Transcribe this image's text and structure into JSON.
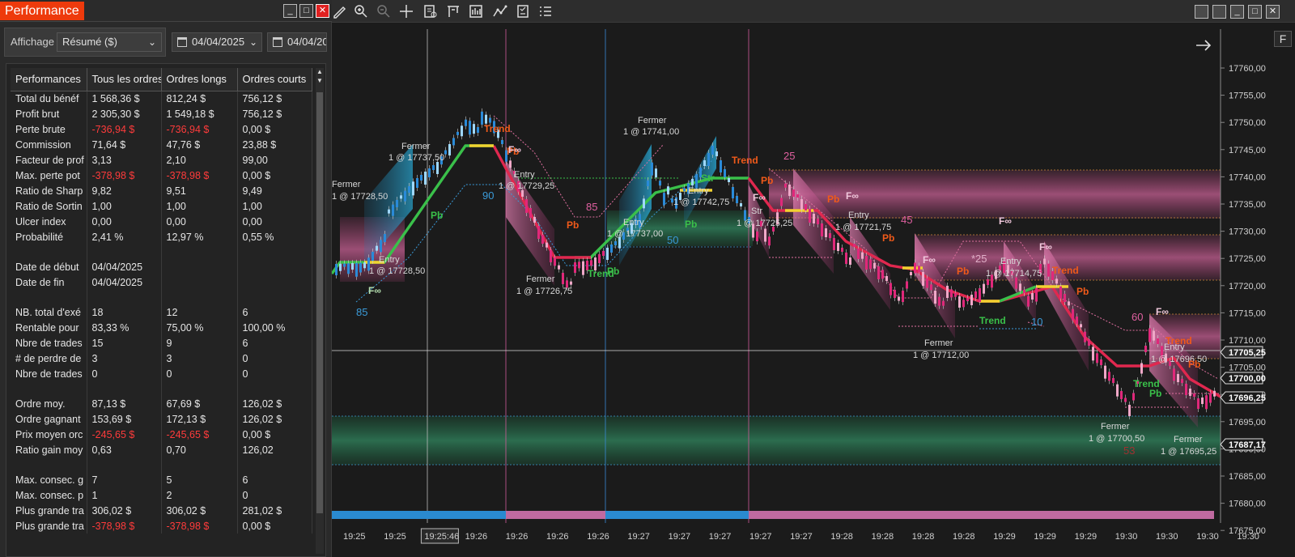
{
  "panel": {
    "title": "Performance",
    "filter_label": "Affichage",
    "view_select": "Résumé ($)",
    "date_from": "04/04/2025",
    "date_to": "04/04/20",
    "columns": [
      "Performances",
      "Tous les ordres",
      "Ordres longs",
      "Ordres courts"
    ],
    "rows": [
      {
        "label": "Total du bénéf",
        "all": "1 568,36 $",
        "long": "812,24 $",
        "short": "756,12 $"
      },
      {
        "label": "Profit brut",
        "all": "2 305,30 $",
        "long": "1 549,18 $",
        "short": "756,12 $"
      },
      {
        "label": "Perte brute",
        "all": "-736,94 $",
        "long": "-736,94 $",
        "short": "0,00 $",
        "neg": [
          true,
          true,
          false
        ]
      },
      {
        "label": "Commission",
        "all": "71,64 $",
        "long": "47,76 $",
        "short": "23,88 $"
      },
      {
        "label": "Facteur de prof",
        "all": "3,13",
        "long": "2,10",
        "short": "99,00"
      },
      {
        "label": "Max. perte pot",
        "all": "-378,98 $",
        "long": "-378,98 $",
        "short": "0,00 $",
        "neg": [
          true,
          true,
          false
        ]
      },
      {
        "label": "Ratio de Sharp",
        "all": "9,82",
        "long": "9,51",
        "short": "9,49"
      },
      {
        "label": "Ratio de Sortin",
        "all": "1,00",
        "long": "1,00",
        "short": "1,00"
      },
      {
        "label": "Ulcer index",
        "all": "0,00",
        "long": "0,00",
        "short": "0,00"
      },
      {
        "label": "Probabilité",
        "all": "2,41 %",
        "long": "12,97 %",
        "short": "0,55 %"
      },
      {
        "gap": true
      },
      {
        "label": "Date de début",
        "all": "04/04/2025",
        "long": "",
        "short": ""
      },
      {
        "label": "Date de fin",
        "all": "04/04/2025",
        "long": "",
        "short": ""
      },
      {
        "gap": true
      },
      {
        "label": "NB. total d'exé",
        "all": "18",
        "long": "12",
        "short": "6"
      },
      {
        "label": "Rentable pour",
        "all": "83,33 %",
        "long": "75,00 %",
        "short": "100,00 %"
      },
      {
        "label": "Nbre de trades",
        "all": "15",
        "long": "9",
        "short": "6"
      },
      {
        "label": "# de perdre de",
        "all": "3",
        "long": "3",
        "short": "0"
      },
      {
        "label": "Nbre de trades",
        "all": "0",
        "long": "0",
        "short": "0"
      },
      {
        "gap": true
      },
      {
        "label": "Ordre moy.",
        "all": "87,13 $",
        "long": "67,69 $",
        "short": "126,02 $"
      },
      {
        "label": "Ordre gagnant",
        "all": "153,69 $",
        "long": "172,13 $",
        "short": "126,02 $"
      },
      {
        "label": "Prix moyen orc",
        "all": "-245,65 $",
        "long": "-245,65 $",
        "short": "0,00 $",
        "neg": [
          true,
          true,
          false
        ]
      },
      {
        "label": "Ratio gain moy",
        "all": "0,63",
        "long": "0,70",
        "short": "126,02"
      },
      {
        "gap": true
      },
      {
        "label": "Max. consec. g",
        "all": "7",
        "long": "5",
        "short": "6"
      },
      {
        "label": "Max. consec. p",
        "all": "1",
        "long": "2",
        "short": "0"
      },
      {
        "label": "Plus grande tra",
        "all": "306,02 $",
        "long": "306,02 $",
        "short": "281,02 $"
      },
      {
        "label": "Plus grande tra",
        "all": "-378,98 $",
        "long": "-378,98 $",
        "short": "0,00 $",
        "neg": [
          true,
          true,
          false
        ]
      }
    ]
  },
  "chart": {
    "right_tag": "F",
    "price_ticks": [
      "17760,00",
      "17755,00",
      "17750,00",
      "17745,00",
      "17740,00",
      "17735,00",
      "17730,00",
      "17725,00",
      "17720,00",
      "17715,00",
      "17710,00",
      "17705,00",
      "17700,00",
      "17695,00",
      "17690,00",
      "17685,00",
      "17680,00",
      "17675,00"
    ],
    "price_tags": [
      "17705,25",
      "17700,00",
      "17696,25",
      "17687,17"
    ],
    "time_ticks": [
      "19:25",
      "19:25",
      "19:25:46",
      "19:26",
      "19:26",
      "19:26",
      "19:26",
      "19:27",
      "19:27",
      "19:27",
      "19:27",
      "19:27",
      "19:28",
      "19:28",
      "19:28",
      "19:28",
      "19:29",
      "19:29",
      "19:29",
      "19:30",
      "19:30",
      "19:30",
      "19:30"
    ],
    "labels": {
      "fermer": "Fermer",
      "entry": "Entry",
      "trend": "Trend",
      "pb": "Pb",
      "fi": "F∞",
      "str": "Str",
      "f1": "1 @ 17728,50",
      "f2": "1 @ 17737,50",
      "f3": "1 @ 17741,00",
      "f4": "1 @ 17726,75",
      "f5": "1 @ 17712,00",
      "f6": "1 @ 17700,50",
      "f7": "1 @ 17695,25",
      "e1": "1 @ 17728,50",
      "e2": "1 @ 17729,25",
      "e3": "1 @ 17737,00",
      "e4": "1 @ 17742,75",
      "e5": "1 @ 17725,25",
      "e6": "1 @ 17721,75",
      "e7": "1 @ 17714,75",
      "e8": "1 @ 17696,50",
      "n85a": "85",
      "n90": "90",
      "n85b": "85",
      "n50": "50",
      "n25": "25",
      "n45": "45",
      "n25b": "*25",
      "n10": "10",
      "n60": "60",
      "n53": "53"
    }
  }
}
